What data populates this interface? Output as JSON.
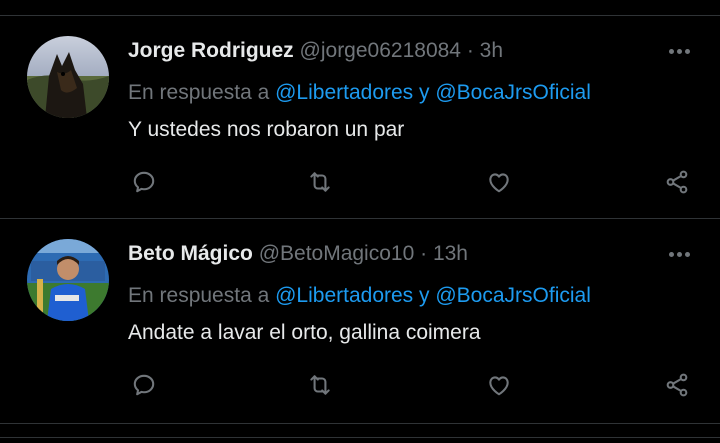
{
  "colors": {
    "background": "#000000",
    "divider": "#2f3336",
    "primary_text": "#e7e9ea",
    "secondary_text": "#71767b",
    "link": "#1d9bf0"
  },
  "tweets": [
    {
      "name": "Jorge Rodriguez",
      "handle": "@jorge06218084",
      "separator": "·",
      "time": "3h",
      "reply_prefix": "En respuesta a",
      "mention1": "@Libertadores",
      "conjunction": "y",
      "mention2": "@BocaJrsOficial",
      "text": "Y ustedes nos robaron un par",
      "icons": {
        "more": "more-options-icon",
        "reply": "reply-icon",
        "retweet": "retweet-icon",
        "like": "heart-icon",
        "share": "share-icon"
      }
    },
    {
      "name": "Beto Mágico",
      "handle": "@BetoMagico10",
      "separator": "·",
      "time": "13h",
      "reply_prefix": "En respuesta a",
      "mention1": "@Libertadores",
      "conjunction": "y",
      "mention2": "@BocaJrsOficial",
      "text": "Andate a lavar el orto, gallina coimera",
      "icons": {
        "more": "more-options-icon",
        "reply": "reply-icon",
        "retweet": "retweet-icon",
        "like": "heart-icon",
        "share": "share-icon"
      }
    }
  ]
}
